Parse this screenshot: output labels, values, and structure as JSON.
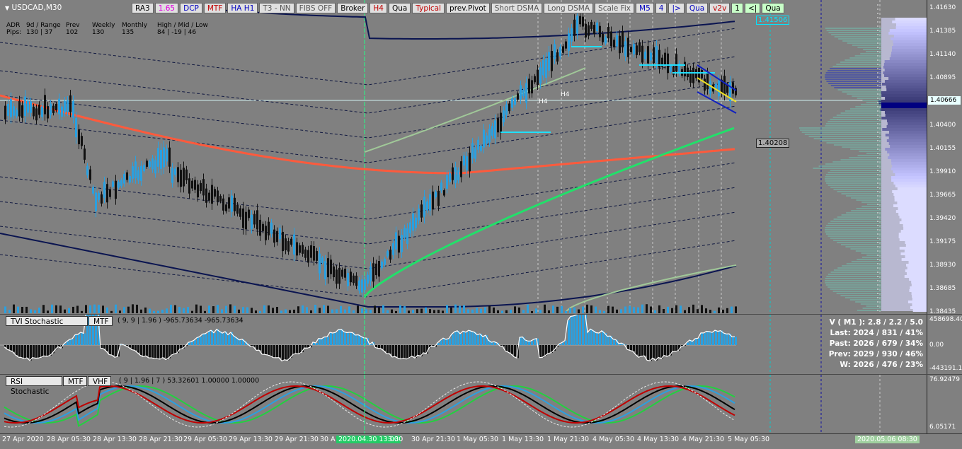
{
  "window": {
    "symbol_title": "USDCAD,M30"
  },
  "toolbar": [
    {
      "label": "RA3",
      "color": "#000000",
      "bg": "#e0e0e0"
    },
    {
      "label": "1.65",
      "color": "#e000e0",
      "bg": "#e0e0e0"
    },
    {
      "label": "DCP",
      "color": "#0000c0",
      "bg": "#e0e0e0"
    },
    {
      "label": "MTF",
      "color": "#c00000",
      "bg": "#e0e0e0"
    },
    {
      "label": "HA H1",
      "color": "#0000c0",
      "bg": "#e0e0e0"
    },
    {
      "label": "T3 - NN",
      "color": "#555555",
      "bg": "#e0e0e0"
    },
    {
      "label": "FIBS OFF",
      "color": "#555555",
      "bg": "#e0e0e0"
    },
    {
      "label": "Broker",
      "color": "#000000",
      "bg": "#e0e0e0"
    },
    {
      "label": "H4",
      "color": "#c00000",
      "bg": "#e0e0e0"
    },
    {
      "label": "Qua",
      "color": "#000000",
      "bg": "#e0e0e0"
    },
    {
      "label": "Typical",
      "color": "#c00000",
      "bg": "#e0e0e0"
    },
    {
      "label": "prev.Pivot",
      "color": "#000000",
      "bg": "#e0e0e0"
    },
    {
      "label": "Short DSMA",
      "color": "#555555",
      "bg": "#e0e0e0"
    },
    {
      "label": "Long DSMA",
      "color": "#555555",
      "bg": "#e0e0e0"
    },
    {
      "label": "Scale Fix",
      "color": "#555555",
      "bg": "#e0e0e0"
    },
    {
      "label": "M5",
      "color": "#0000c0",
      "bg": "#e0e0e0"
    },
    {
      "label": "4",
      "color": "#0000c0",
      "bg": "#e0e0e0"
    },
    {
      "label": "|>",
      "color": "#0000c0",
      "bg": "#e0e0e0"
    },
    {
      "label": "Qua",
      "color": "#0000c0",
      "bg": "#e0e0e0"
    },
    {
      "label": "v2v",
      "color": "#c00000",
      "bg": "#e0e0e0"
    },
    {
      "label": "1",
      "color": "#000000",
      "bg": "#c8ffc8"
    },
    {
      "label": "<|",
      "color": "#000000",
      "bg": "#c8ffc8"
    },
    {
      "label": "Qua",
      "color": "#000000",
      "bg": "#c8ffc8"
    }
  ],
  "adr": {
    "row1": [
      "ADR",
      "9d / Range",
      "Prev",
      "Weekly",
      "Monthly",
      "High / Mid / Low"
    ],
    "row2": [
      "Pips:",
      "130 | 37",
      "102",
      "130",
      "135",
      "84 | -19 | 46"
    ]
  },
  "price_axis": [
    "1.41630",
    "1.41385",
    "1.41140",
    "1.40895",
    "1.40666",
    "1.40400",
    "1.40155",
    "1.39910",
    "1.39665",
    "1.39420",
    "1.39175",
    "1.38930",
    "1.38685",
    "1.38435"
  ],
  "price_labels": {
    "upper": "1.41506",
    "lower": "1.40208",
    "current": "1.40666"
  },
  "chart_marks": {
    "h4_a": "H4",
    "h4_b": "H4"
  },
  "tvi": {
    "name": "TVI Stochastic",
    "mtf": "MTF",
    "params": "( 9, 9 | 1.96 ) -965.73634 -965.73634",
    "scale": [
      "458698.40",
      "0.00",
      "-443191.1"
    ]
  },
  "stats": [
    "V ( M1 ): 2.8 / 2.2 / 5.0",
    "Last: 2024 / 831 / 41%",
    "Past: 2026 / 679 / 34%",
    "Prev: 2029 / 930 / 46%",
    "W: 2026 / 476 / 23%"
  ],
  "rsi": {
    "name": "RSI Stochastic",
    "mtf": "MTF",
    "vhf": "VHF",
    "params": "( 9 | 1.96 | 7 ) 53.32601 1.00000 1.00000",
    "scale": [
      "76.92479",
      "6.05171"
    ]
  },
  "time_axis": [
    "27 Apr 2020",
    "28 Apr 05:30",
    "28 Apr 13:30",
    "28 Apr 21:30",
    "29 Apr 05:30",
    "29 Apr 13:30",
    "29 Apr 21:30",
    "30 A",
    "2020.04.30 13:00",
    "3:30",
    "30 Apr 21:30",
    "1 May 05:30",
    "1 May 13:30",
    "1 May 21:30",
    "4 May 05:30",
    "4 May 13:30",
    "4 May 21:30",
    "5 May 05:30",
    "2020.05.06 08:30"
  ],
  "colors": {
    "bull": "#2aa0e0",
    "bear": "#111111",
    "ma_red": "#ff5a3c",
    "ma_green": "#22e06a",
    "band_navy": "#0a1450",
    "band_pale": "#a0c898"
  }
}
